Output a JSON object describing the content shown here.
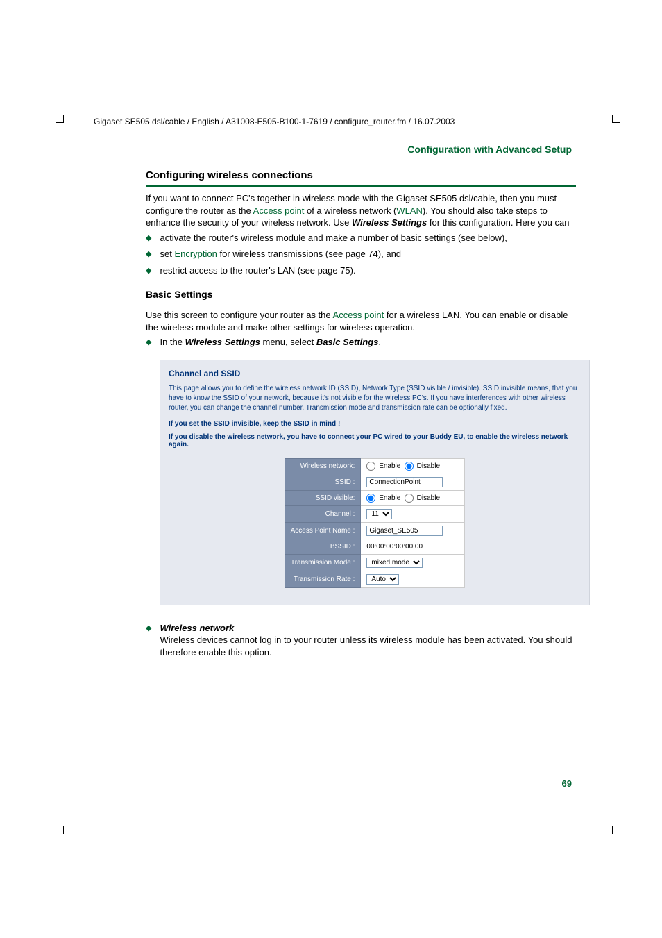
{
  "header_path": "Gigaset SE505 dsl/cable / English / A31008-E505-B100-1-7619 / configure_router.fm / 16.07.2003",
  "page_header_right": "Configuration with Advanced Setup",
  "section_heading": "Configuring wireless connections",
  "intro_p1a": "If you want to connect PC's together in wireless mode with the Gigaset SE505 dsl/cable, then you must configure the router as the ",
  "intro_link1": "Access point",
  "intro_p1b": " of a wireless network (",
  "intro_link2": "WLAN",
  "intro_p1c": "). You should also take steps to enhance the security of your wireless network. Use ",
  "intro_bold1": "Wireless Settings",
  "intro_p1d": " for this configuration. Here you can",
  "bullet1": "activate the router's wireless module and make a number of basic settings (see below),",
  "bullet2a": "set ",
  "bullet2link": "Encryption",
  "bullet2b": " for wireless transmissions (see page 74), and",
  "bullet3": "restrict access to the router's LAN (see page 75).",
  "subsection_heading": "Basic Settings",
  "sub_p1a": "Use this screen to configure your router as the ",
  "sub_p1link": "Access point",
  "sub_p1b": " for a wireless LAN. You can enable or disable the wireless module and make other settings for wireless operation.",
  "sub_bullet1a": "In the ",
  "sub_bullet1b": "Wireless Settings",
  "sub_bullet1c": " menu, select ",
  "sub_bullet1d": "Basic Settings",
  "sub_bullet1e": ".",
  "screenshot": {
    "title": "Channel and SSID",
    "desc": "This page allows you to define the wireless network ID (SSID), Network Type (SSID visible / invisible). SSID invisible means, that you have to know the SSID of your network, because it's not visible for the wireless PC's. If you have interferences with other wireless router, you can change the channel number. Transmission mode and transmission rate can be optionally fixed.",
    "warn1": "If you set the SSID invisible, keep the SSID in mind !",
    "warn2": "If you disable the wireless network, you have to connect your PC wired to your Buddy EU, to enable the wireless network again.",
    "rows": {
      "wireless_network_label": "Wireless network:",
      "enable_label": "Enable",
      "disable_label": "Disable",
      "ssid_label": "SSID :",
      "ssid_value": "ConnectionPoint",
      "ssid_visible_label": "SSID visible:",
      "channel_label": "Channel :",
      "channel_value": "11",
      "ap_name_label": "Access Point Name :",
      "ap_name_value": "Gigaset_SE505",
      "bssid_label": "BSSID :",
      "bssid_value": "00:00:00:00:00:00",
      "tx_mode_label": "Transmission Mode :",
      "tx_mode_value": "mixed mode",
      "tx_rate_label": "Transmission Rate :",
      "tx_rate_value": "Auto"
    }
  },
  "post_bullet_title": "Wireless network",
  "post_bullet_text": "Wireless devices cannot log in to your router unless its wireless module has been activated. You should therefore enable this option.",
  "page_number": "69"
}
